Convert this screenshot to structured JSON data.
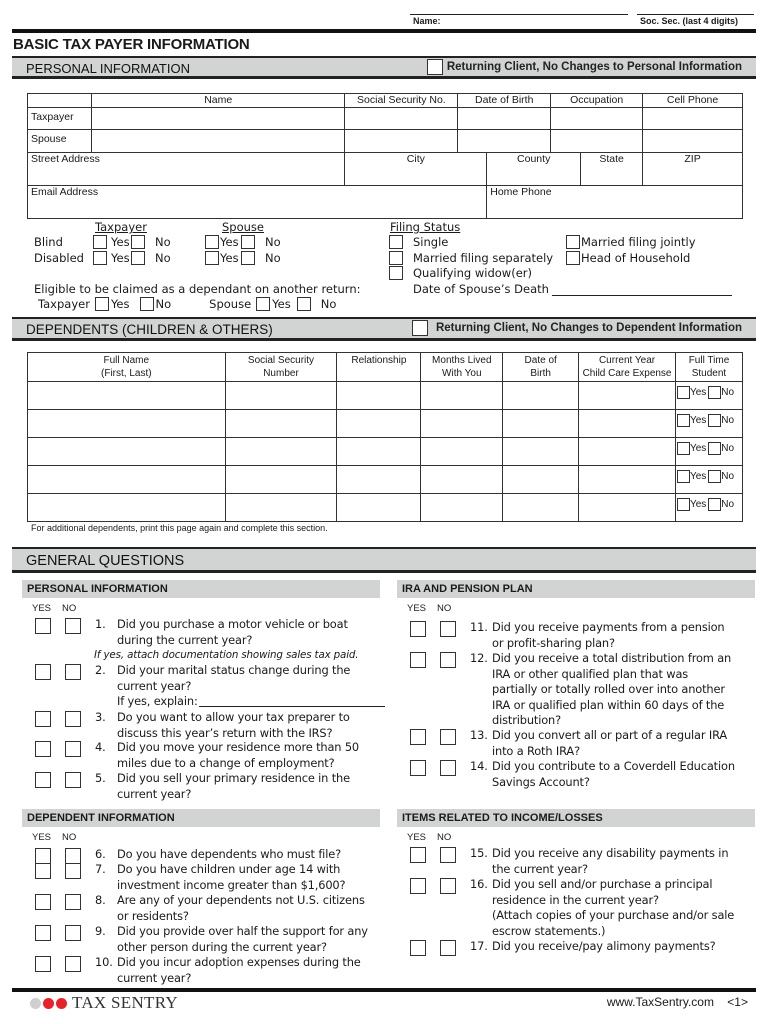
{
  "header": {
    "name_label": "Name:",
    "ssn_label": "Soc. Sec. (last 4 digits)",
    "title": "BASIC TAX PAYER INFORMATION"
  },
  "personal": {
    "band_title": "PERSONAL INFORMATION",
    "returning_label": "Returning Client, No Changes to Personal Information",
    "columns": [
      "Name",
      "Social Security No.",
      "Date of Birth",
      "Occupation",
      "Cell Phone"
    ],
    "rows": [
      "Taxpayer",
      "Spouse"
    ],
    "address_fields": [
      "Street Address",
      "City",
      "County",
      "State",
      "ZIP"
    ],
    "email_label": "Email Address",
    "home_phone_label": "Home Phone",
    "taxpayer_head": "Taxpayer",
    "spouse_head": "Spouse",
    "blind_label": "Blind",
    "disabled_label": "Disabled",
    "yes": "Yes",
    "no": "No",
    "eligible_label": "Eligible to be claimed as a dependant on another return:",
    "eligible_taxpayer": "Taxpayer",
    "eligible_spouse": "Spouse"
  },
  "filing_status": {
    "title": "Filing Status",
    "options": [
      "Single",
      "Married filing separately",
      "Qualifying widow(er)",
      "Married filing jointly",
      "Head of Household"
    ],
    "spouse_death_label": "Date of Spouse’s Death"
  },
  "dependents": {
    "band_title": "DEPENDENTS (CHILDREN & OTHERS)",
    "returning_label": "Returning Client, No Changes to Dependent Information",
    "columns": [
      [
        "Full Name",
        "(First, Last)"
      ],
      [
        "Social Security",
        "Number"
      ],
      [
        "Relationship",
        ""
      ],
      [
        "Months Lived",
        "With You"
      ],
      [
        "Date of",
        "Birth"
      ],
      [
        "Current Year",
        "Child Care Expense"
      ],
      [
        "Full Time",
        "Student"
      ]
    ],
    "row_count": 5,
    "yes": "Yes",
    "no": "No",
    "note": "For additional dependents, print this page again and complete this section."
  },
  "general": {
    "band_title": "GENERAL QUESTIONS",
    "yes_label": "YES",
    "no_label": "NO",
    "sections": [
      {
        "title": "PERSONAL INFORMATION",
        "questions": [
          {
            "num": "1.",
            "lines": [
              "Did you purchase a motor vehicle or boat",
              "during the current year?"
            ],
            "note": "If yes, attach documentation showing sales tax paid."
          },
          {
            "num": "2.",
            "lines": [
              "Did your marital status change during the",
              "current year?",
              "If yes, explain:"
            ]
          },
          {
            "num": "3.",
            "lines": [
              "Do you want to allow your tax preparer to",
              "discuss this year’s return with the IRS?"
            ]
          },
          {
            "num": "4.",
            "lines": [
              "Did you move your residence more than 50",
              "miles due to a change of employment?"
            ]
          },
          {
            "num": "5.",
            "lines": [
              "Did you sell your primary residence in the",
              "current year?"
            ]
          }
        ]
      },
      {
        "title": "IRA AND PENSION PLAN",
        "questions": [
          {
            "num": "11.",
            "lines": [
              "Did you receive payments from a pension",
              "or profit-sharing plan?"
            ]
          },
          {
            "num": "12.",
            "lines": [
              "Did you receive a total distribution from an",
              "IRA or other qualified plan that was",
              "partially or totally rolled over into another",
              "IRA or qualified plan within 60 days of the",
              "distribution?"
            ]
          },
          {
            "num": "13.",
            "lines": [
              "Did you convert all or part of a regular IRA",
              "into a Roth IRA?"
            ]
          },
          {
            "num": "14.",
            "lines": [
              "Did you contribute to a Coverdell Education",
              "Savings Account?"
            ]
          }
        ]
      },
      {
        "title": "DEPENDENT INFORMATION",
        "questions": [
          {
            "num": "6.",
            "lines": [
              "Do you have dependents who must file?"
            ]
          },
          {
            "num": "7.",
            "lines": [
              "Do you have children under age 14 with",
              "investment income greater than $1,600?"
            ]
          },
          {
            "num": "8.",
            "lines": [
              "Are any of your dependents not U.S. citizens",
              "or residents?"
            ]
          },
          {
            "num": "9.",
            "lines": [
              "Did you provide over half the support for any",
              "other person during the current year?"
            ]
          },
          {
            "num": "10.",
            "lines": [
              "Did you incur adoption expenses during the",
              "current year?"
            ]
          }
        ]
      },
      {
        "title": "ITEMS RELATED TO INCOME/LOSSES",
        "questions": [
          {
            "num": "15.",
            "lines": [
              "Did you receive any disability payments in",
              "the current year?"
            ]
          },
          {
            "num": "16.",
            "lines": [
              "Did you sell and/or purchase a principal",
              "residence in the current year?",
              "(Attach copies of your purchase and/or sale",
              "escrow statements.)"
            ]
          },
          {
            "num": "17.",
            "lines": [
              "Did you receive/pay alimony payments?"
            ]
          }
        ]
      }
    ]
  },
  "footer": {
    "logo_text": "TAX SENTRY",
    "logo_colors": [
      "#cfcfcf",
      "#e8222a",
      "#e8222a"
    ],
    "website": "www.TaxSentry.com",
    "page": "<1>"
  }
}
